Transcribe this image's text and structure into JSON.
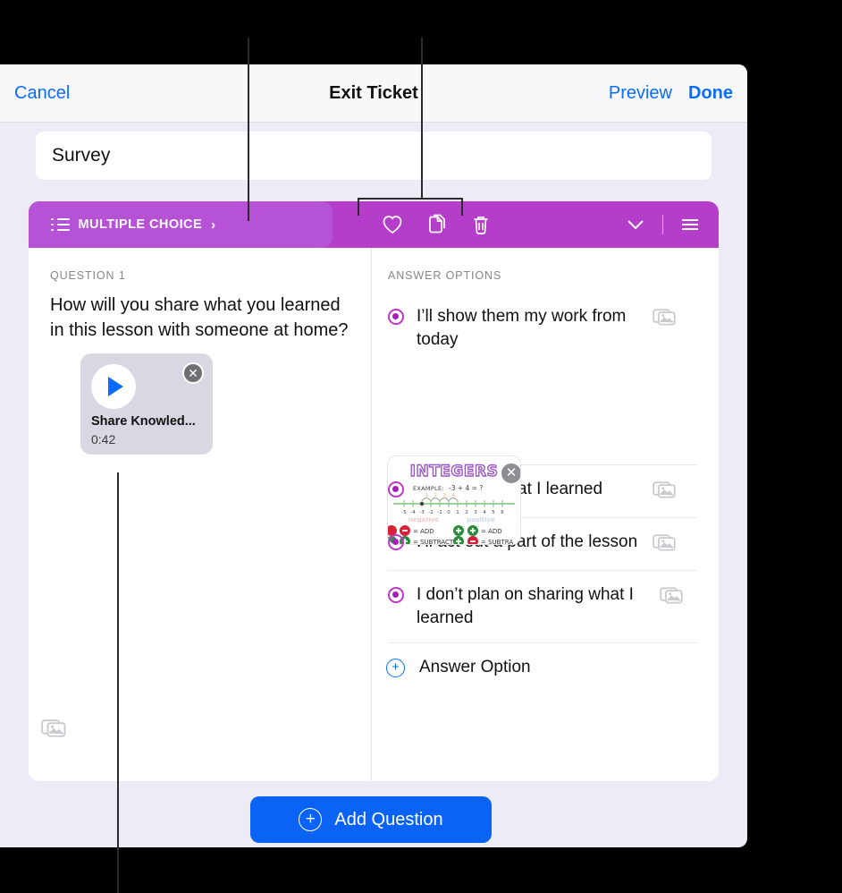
{
  "navbar": {
    "cancel_label": "Cancel",
    "title": "Exit Ticket",
    "preview_label": "Preview",
    "done_label": "Done"
  },
  "title_field": {
    "value": "Survey"
  },
  "question_card": {
    "toolbar": {
      "type_label": "MULTIPLE CHOICE",
      "list_icon": "bulleted-list-icon",
      "chevron_right": "›",
      "favorite_icon": "heart-icon",
      "duplicate_icon": "duplicate-pages-icon",
      "delete_icon": "trash-icon",
      "collapse_icon": "chevron-down-icon",
      "reorder_icon": "hamburger-handle-icon",
      "gradient_start": "#B552D6",
      "gradient_end": "#B43DC9"
    },
    "question": {
      "section_label": "QUESTION 1",
      "text": "How will you share what you learned in this lesson with someone at home?",
      "photo_icon": "add-photo-icon",
      "audio": {
        "title": "Share Knowled...",
        "duration": "0:42",
        "play_icon": "play-icon",
        "remove_icon": "remove-x-icon"
      }
    },
    "answers": {
      "section_label": "ANSWER OPTIONS",
      "options": [
        {
          "text": "I’ll show them my work from today",
          "photo_icon": "add-photo-icon",
          "has_media": true
        },
        {
          "text": "I’ll explain what I learned",
          "photo_icon": "add-photo-icon",
          "has_media": false
        },
        {
          "text": "I’ll act out a part of the lesson",
          "photo_icon": "add-photo-icon",
          "has_media": false
        },
        {
          "text": "I don’t plan on sharing what I learned",
          "photo_icon": "add-photo-icon",
          "has_media": false
        }
      ],
      "media_thumbnail": {
        "heading": "INTEGERS",
        "example": "EXAMPLE: -3 + 4 = ?",
        "number_line_ticks": [
          "-5",
          "-4",
          "-3",
          "-2",
          "-1",
          "0",
          "1",
          "2",
          "3",
          "4",
          "5",
          "6"
        ],
        "negative_label": "negative",
        "positive_label": "positive",
        "rules": [
          {
            "signs": [
              "minus",
              "minus"
            ],
            "result": "ADD"
          },
          {
            "signs": [
              "plus",
              "plus"
            ],
            "result": "ADD"
          },
          {
            "signs": [
              "plus",
              "minus"
            ],
            "result": "SUBTRACT"
          },
          {
            "signs": [
              "plus",
              "minus"
            ],
            "result": "SUBTRA"
          }
        ],
        "remove_icon": "remove-x-icon",
        "accent_color": "#9B59C6"
      },
      "add_option": {
        "label": "Answer Option",
        "icon": "plus-circle-icon"
      }
    }
  },
  "footer": {
    "add_question_label": "Add Question",
    "add_question_icon": "plus-circle-icon",
    "accent_color": "#0A63F5"
  }
}
